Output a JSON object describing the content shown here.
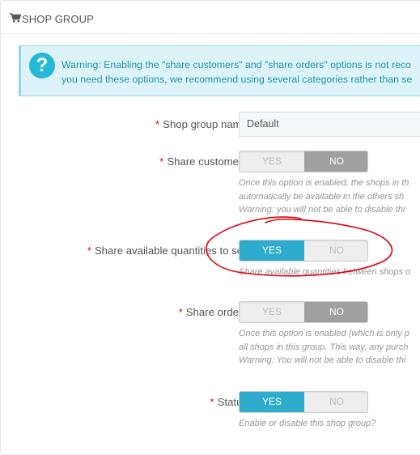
{
  "panel": {
    "title": "SHOP GROUP"
  },
  "alert": {
    "icon": "question-icon",
    "line1": "Warning: Enabling the \"share customers\" and \"share orders\" options is not reco",
    "line2": "you need these options, we recommend using several categories rather than se"
  },
  "fields": {
    "name": {
      "label": "Shop group name",
      "value": "Default"
    },
    "share_customers": {
      "label": "Share customers",
      "yes": "YES",
      "no": "NO",
      "selected": "NO",
      "help": [
        "Once this option is enabled, the shops in th",
        "automatically be available in the others sh",
        "Warning: you will not be able to disable thi"
      ]
    },
    "share_stock": {
      "label": "Share available quantities to sell",
      "yes": "YES",
      "no": "NO",
      "selected": "YES",
      "help": [
        "Share available quantities between shops o"
      ]
    },
    "share_orders": {
      "label": "Share orders",
      "yes": "YES",
      "no": "NO",
      "selected": "NO",
      "help": [
        "Once this option is enabled (which is only p",
        "all shops in this group. This way, any purch",
        "Warning: You will not be able to disable thi"
      ]
    },
    "status": {
      "label": "Status",
      "yes": "YES",
      "no": "NO",
      "selected": "YES",
      "help": [
        "Enable or disable this shop group?"
      ]
    }
  },
  "required_mark": "*",
  "colors": {
    "accent": "#2eacce",
    "alert_bg": "#dcf4f9",
    "alert_text": "#1e94ab",
    "annotation": "#e0000f"
  }
}
